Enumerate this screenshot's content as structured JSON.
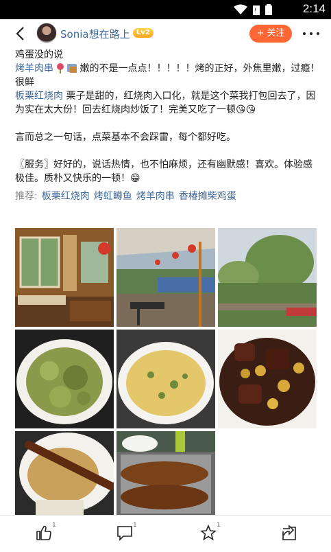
{
  "status": {
    "time": "2:14"
  },
  "header": {
    "username": "Sonia想在路上",
    "level": "Lv2",
    "follow_label": "+ 关注"
  },
  "review": {
    "line1": "鸡蛋没的说",
    "dish1": "烤羊肉串",
    "line2_rest": "嫩的不是一点点！！！！！烤的正好，外焦里嫩，过瘾！很鲜",
    "dish2": "板栗红烧肉",
    "line3_rest": " 栗子是甜的，红烧肉入口化，就是这个菜我打包回去了，因为实在太大份！回去红烧肉炒饭了！完美又吃了一顿😘😘",
    "summary": "言而总之一句话，点菜基本不会踩雷，每个都好吃。",
    "service": "〖服务〗好好的，说话热情，也不怕麻烦，还有幽默感！喜欢。体验感极佳。质朴又快乐的一顿！😁"
  },
  "recommend": {
    "label": "推荐:",
    "items": [
      "板栗红烧肉",
      "烤虹鳟鱼",
      "烤羊肉串",
      "香椿摊柴鸡蛋"
    ]
  },
  "photos": [
    "restaurant-interior",
    "outdoor-terrace",
    "garden-view",
    "fried-toon-leaves",
    "toon-omelette",
    "braised-pork-chestnut",
    "lamb-skewer-noodles",
    "grilled-trout"
  ],
  "actions": {
    "like_count": "1",
    "comment_count": "1",
    "favorite_count": "1"
  }
}
